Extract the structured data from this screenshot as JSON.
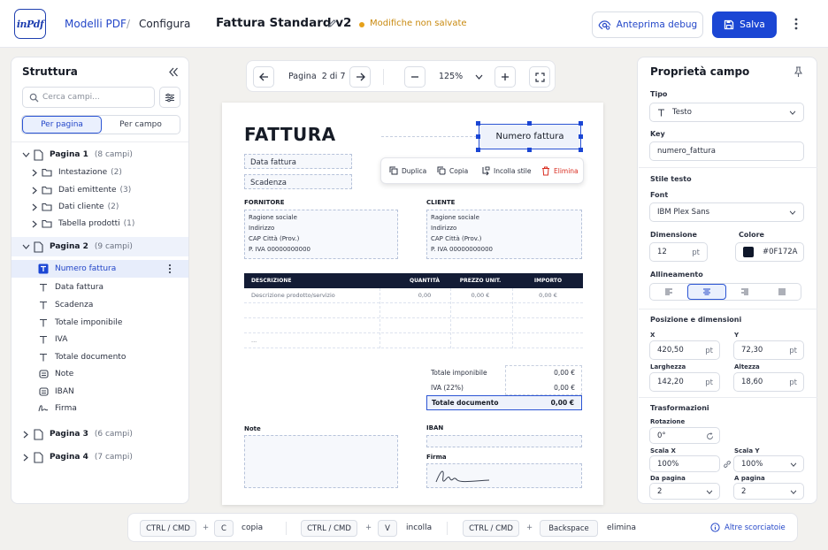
{
  "app": {
    "logo": "inPdf"
  },
  "header": {
    "crumb_root": "Modelli PDF",
    "crumb_sep": "/",
    "crumb_current": "Configura",
    "doc_title": "Fattura Standard v2",
    "unsaved": "Modifiche non salvate",
    "debug_label": "Anteprima debug",
    "save_label": "Salva"
  },
  "left": {
    "title": "Struttura",
    "search_placeholder": "Cerca campi...",
    "tab_page": "Per pagina",
    "tab_field": "Per campo",
    "pages": [
      {
        "label": "Pagina 1",
        "count": "(8 campi)"
      },
      {
        "label": "Pagina 2",
        "count": "(9 campi)"
      },
      {
        "label": "Pagina 3",
        "count": "(6 campi)"
      },
      {
        "label": "Pagina 4",
        "count": "(7 campi)"
      }
    ],
    "groups": [
      {
        "label": "Intestazione",
        "count": "(2)"
      },
      {
        "label": "Dati emittente",
        "count": "(3)"
      },
      {
        "label": "Dati cliente",
        "count": "(2)"
      },
      {
        "label": "Tabella prodotti",
        "count": "(1)"
      }
    ],
    "fields": [
      {
        "label": "Numero fattura"
      },
      {
        "label": "Data fattura"
      },
      {
        "label": "Scadenza"
      },
      {
        "label": "Totale imponibile"
      },
      {
        "label": "IVA"
      },
      {
        "label": "Totale documento"
      },
      {
        "label": "Note"
      },
      {
        "label": "IBAN"
      },
      {
        "label": "Firma"
      }
    ]
  },
  "toolbar": {
    "page_label": "Pagina",
    "page_num": "2 di 7",
    "zoom": "125%"
  },
  "doc": {
    "title": "FATTURA",
    "numero": "Numero fattura",
    "data": "Data fattura",
    "scadenza": "Scadenza",
    "ctx": {
      "duplica": "Duplica",
      "copia": "Copia",
      "incolla": "Incolla stile",
      "elimina": "Elimina"
    },
    "fornitore": "FORNITORE",
    "cliente": "CLIENTE",
    "addr": [
      "Ragione sociale",
      "Indirizzo",
      "CAP Città (Prov.)",
      "P. IVA 00000000000"
    ],
    "table": {
      "headers": [
        "DESCRIZIONE",
        "QUANTITÀ",
        "PREZZO UNIT.",
        "IMPORTO"
      ],
      "row1": [
        "Descrizione prodotto/servizio",
        "0,00",
        "0,00 €",
        "0,00 €"
      ],
      "ellipsis": "..."
    },
    "totals": [
      {
        "label": "Totale imponibile",
        "value": "0,00 €"
      },
      {
        "label": "IVA (22%)",
        "value": "0,00 €"
      },
      {
        "label": "Totale documento",
        "value": "0,00 €"
      }
    ],
    "note": "Note",
    "iban": "IBAN",
    "firma": "Firma"
  },
  "right": {
    "title": "Proprietà campo",
    "tipo_label": "Tipo",
    "tipo_value": "Testo",
    "key_label": "Key",
    "key_value": "numero_fattura",
    "stile_title": "Stile testo",
    "font_label": "Font",
    "font_value": "IBM Plex Sans",
    "dim_label": "Dimensione",
    "dim_value": "12",
    "dim_unit": "pt",
    "colore_label": "Colore",
    "colore_value": "#0F172A",
    "align_label": "Allineamento",
    "pos_title": "Posizione e dimensioni",
    "x_label": "X",
    "x_value": "420,50",
    "y_label": "Y",
    "y_value": "72,30",
    "w_label": "Larghezza",
    "w_value": "142,20",
    "h_label": "Altezza",
    "h_value": "18,60",
    "unit": "pt",
    "trasf_title": "Trasformazioni",
    "rot_label": "Rotazione",
    "rot_value": "0°",
    "sx_label": "Scala X",
    "sx_value": "100%",
    "sy_label": "Scala Y",
    "sy_value": "100%",
    "da_label": "Da pagina",
    "da_value": "2",
    "a_label": "A pagina",
    "a_value": "2"
  },
  "shortcuts": {
    "mod": "CTRL / CMD",
    "plus": "+",
    "c": "C",
    "copia": "copia",
    "v": "V",
    "incolla": "incolla",
    "bs": "Backspace",
    "elimina": "elimina",
    "altre": "Altre scorciatoie"
  },
  "colors": {
    "accent": "#1B46D4",
    "dark": "#0F172A",
    "warning": "#E6A11A",
    "danger": "#D92D20"
  }
}
